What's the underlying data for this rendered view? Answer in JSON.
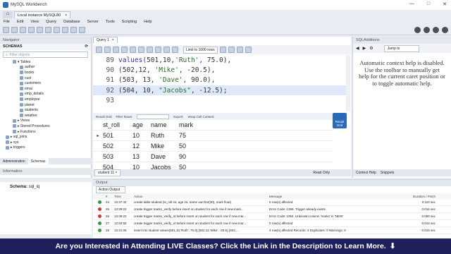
{
  "window": {
    "title": "MySQL Workbench",
    "controls": [
      "—",
      "□",
      "✕"
    ]
  },
  "tabs": {
    "home": "⌂",
    "connection": "Local instance MySQL80",
    "close": "×"
  },
  "menu": [
    "File",
    "Edit",
    "View",
    "Query",
    "Database",
    "Server",
    "Tools",
    "Scripting",
    "Help"
  ],
  "navigator": {
    "header": "Navigator",
    "schemas_label": "SCHEMAS",
    "filter_placeholder": "Filter objects",
    "tree": [
      "▾ Tables",
      "author",
      "books",
      "cust",
      "customers",
      "emai",
      "emp_details",
      "employee",
      "planet",
      "students",
      "weather",
      "▸ Views",
      "▸ Stored Procedures",
      "▸ Functions",
      "▸ sql_joins",
      "▸ sys",
      "▸ triggers"
    ],
    "tab_admin": "Administration",
    "tab_schemas": "Schemas"
  },
  "information": {
    "header": "Information",
    "schema_label": "Schema:",
    "schema_value": "sql_iq"
  },
  "editor": {
    "tab": "Query 1",
    "tab_close": "×",
    "limit": "Limit to 1000 rows",
    "lines": [
      {
        "num": "89",
        "parts": [
          {
            "t": "values(",
            "c": "kw"
          },
          {
            "t": "501,10,",
            "c": "num"
          },
          {
            "t": "'Ruth'",
            "c": "str"
          },
          {
            "t": ", 75.0),",
            "c": "num"
          }
        ]
      },
      {
        "num": "90",
        "parts": [
          {
            "t": "(502,12, ",
            "c": "num"
          },
          {
            "t": "'Mike'",
            "c": "str"
          },
          {
            "t": ", -20.5),",
            "c": "num"
          }
        ]
      },
      {
        "num": "91",
        "parts": [
          {
            "t": "(503, 13, ",
            "c": "num"
          },
          {
            "t": "'Dave'",
            "c": "str"
          },
          {
            "t": ", 90.0),",
            "c": "num"
          }
        ]
      },
      {
        "num": "92",
        "parts": [
          {
            "t": "(504, 10, ",
            "c": "num"
          },
          {
            "t": "\"Jacobs\"",
            "c": "str"
          },
          {
            "t": ", -12.5);",
            "c": "num"
          }
        ]
      },
      {
        "num": "93",
        "parts": []
      }
    ]
  },
  "result": {
    "toolbar": {
      "grid": "Result Grid",
      "filter": "Filter Rows:",
      "export": "Export:",
      "wrap": "Wrap Cell Content:"
    },
    "columns": [
      "st_roll",
      "age",
      "name",
      "mark"
    ],
    "rows": [
      [
        "501",
        "10",
        "Ruth",
        "75"
      ],
      [
        "502",
        "12",
        "Mike",
        "50"
      ],
      [
        "503",
        "13",
        "Dave",
        "90"
      ],
      [
        "504",
        "10",
        "Jacobs",
        "50"
      ]
    ],
    "side_button": "Result Grid",
    "tab": "student 11 ×",
    "read_only": "Read Only"
  },
  "sqladditions": {
    "header": "SQLAdditions",
    "jump": "Jump to",
    "help": "Automatic context help is disabled. Use the toolbar to manually get help for the current caret position or to toggle automatic help.",
    "tab_context": "Context Help",
    "tab_snippets": "Snippets"
  },
  "output": {
    "header": "Output",
    "selector": "Action Output",
    "columns": [
      "#",
      "Time",
      "Action",
      "Message",
      "Duration / Fetch"
    ],
    "rows": [
      {
        "status": "ok",
        "num": "24",
        "time": "13:37:42",
        "action": "create table student (st_roll int, age int, name varchar(30), mark float)",
        "message": "0 row(s) affected",
        "duration": "0.110 sec"
      },
      {
        "status": "err",
        "num": "25",
        "time": "13:39:22",
        "action": "create trigger marks_verify before insert on student for each row if new.mark...",
        "message": "Error Code: 1359. Trigger already exists",
        "duration": "0.016 sec"
      },
      {
        "status": "err",
        "num": "26",
        "time": "13:39:22",
        "action": "create trigger marks_verify_st before insert on student for each row if new.mar...",
        "message": "Error Code: 1054. Unknown column 'marks' in 'NEW'",
        "duration": "0.000 sec"
      },
      {
        "status": "ok",
        "num": "27",
        "time": "12:40:55",
        "action": "create trigger marks_verify_st before insert on student for each row if new.mar...",
        "message": "0 row(s) affected",
        "duration": "0.016 sec"
      },
      {
        "status": "ok",
        "num": "28",
        "time": "13:41:05",
        "action": "insert into student values(501,10,'Ruth', 75.0),(502,12,'Mike', -20.5),(503,...",
        "message": "4 row(s) affected Records: 4  Duplicates: 0  Warnings: 0",
        "duration": "0.015 sec"
      }
    ]
  },
  "banner": {
    "text": "Are you Interested in Attending LIVE Classes? Click the Link in the Description to Learn More.",
    "arrow": "⬇"
  },
  "colors": {
    "accent": "#2a69b8",
    "banner": "#1f1f5c",
    "ok": "#2d9b3a",
    "error": "#d23a2f"
  }
}
